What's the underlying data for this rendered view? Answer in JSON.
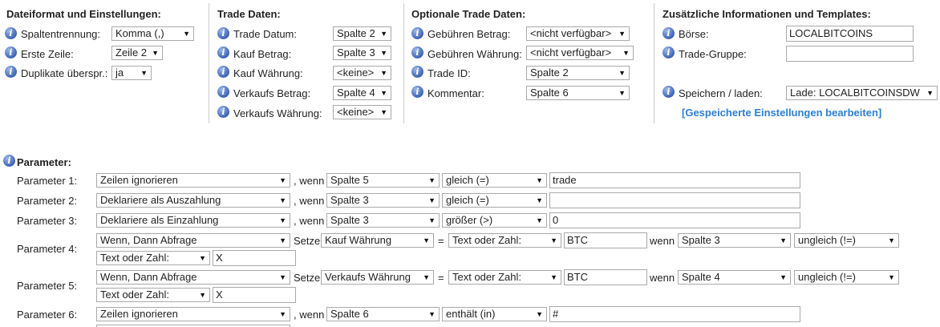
{
  "sec1": {
    "title": "Dateiformat und Einstellungen:",
    "rows": [
      {
        "label": "Spaltentrennung:",
        "value": "Komma (,)"
      },
      {
        "label": "Erste Zeile:",
        "value": "Zeile 2"
      },
      {
        "label": "Duplikate überspr.:",
        "value": "ja"
      }
    ]
  },
  "sec2": {
    "title": "Trade Daten:",
    "rows": [
      {
        "label": "Trade Datum:",
        "value": "Spalte 2"
      },
      {
        "label": "Kauf Betrag:",
        "value": "Spalte 3"
      },
      {
        "label": "Kauf Währung:",
        "value": "<keine>"
      },
      {
        "label": "Verkaufs Betrag:",
        "value": "Spalte 4"
      },
      {
        "label": "Verkaufs Währung:",
        "value": "<keine>"
      }
    ]
  },
  "sec3": {
    "title": "Optionale Trade Daten:",
    "rows": [
      {
        "label": "Gebühren Betrag:",
        "value": "<nicht verfügbar>"
      },
      {
        "label": "Gebühren Währung:",
        "value": "<nicht verfügbar>"
      },
      {
        "label": "Trade ID:",
        "value": "Spalte 2"
      },
      {
        "label": "Kommentar:",
        "value": "Spalte 6"
      }
    ]
  },
  "sec4": {
    "title": "Zusätzliche Informationen und Templates:",
    "boerse_label": "Börse:",
    "boerse_value": "LOCALBITCOINS",
    "gruppe_label": "Trade-Gruppe:",
    "gruppe_value": "",
    "save_label": "Speichern / laden:",
    "save_value": "Lade: LOCALBITCOINSDW",
    "edit_link": "[Gespeicherte Einstellungen bearbeiten]"
  },
  "params": {
    "title": "Parameter:",
    "wenn": ", wenn",
    "setze": "Setze",
    "eq": "=",
    "wenn2": "wenn",
    "rows": [
      {
        "label": "Parameter 1:",
        "action": "Zeilen ignorieren",
        "col": "Spalte 5",
        "op": "gleich (=)",
        "value": "trade"
      },
      {
        "label": "Parameter 2:",
        "action": "Deklariere als Auszahlung",
        "col": "Spalte 3",
        "op": "gleich (=)",
        "value": ""
      },
      {
        "label": "Parameter 3:",
        "action": "Deklariere als Einzahlung",
        "col": "Spalte 3",
        "op": "größer (>)",
        "value": "0"
      },
      {
        "label": "Parameter 4:",
        "action": "Wenn, Dann Abfrage",
        "target": "Kauf Währung",
        "type1": "Text oder Zahl:",
        "val1": "BTC",
        "col": "Spalte 3",
        "op": "ungleich (!=)",
        "type2": "Text oder Zahl:",
        "val2": "X"
      },
      {
        "label": "Parameter 5:",
        "action": "Wenn, Dann Abfrage",
        "target": "Verkaufs Währung",
        "type1": "Text oder Zahl:",
        "val1": "BTC",
        "col": "Spalte 4",
        "op": "ungleich (!=)",
        "type2": "Text oder Zahl:",
        "val2": "X"
      },
      {
        "label": "Parameter 6:",
        "action": "Zeilen ignorieren",
        "col": "Spalte 6",
        "op": "enthält (in)",
        "value": "#"
      }
    ]
  }
}
